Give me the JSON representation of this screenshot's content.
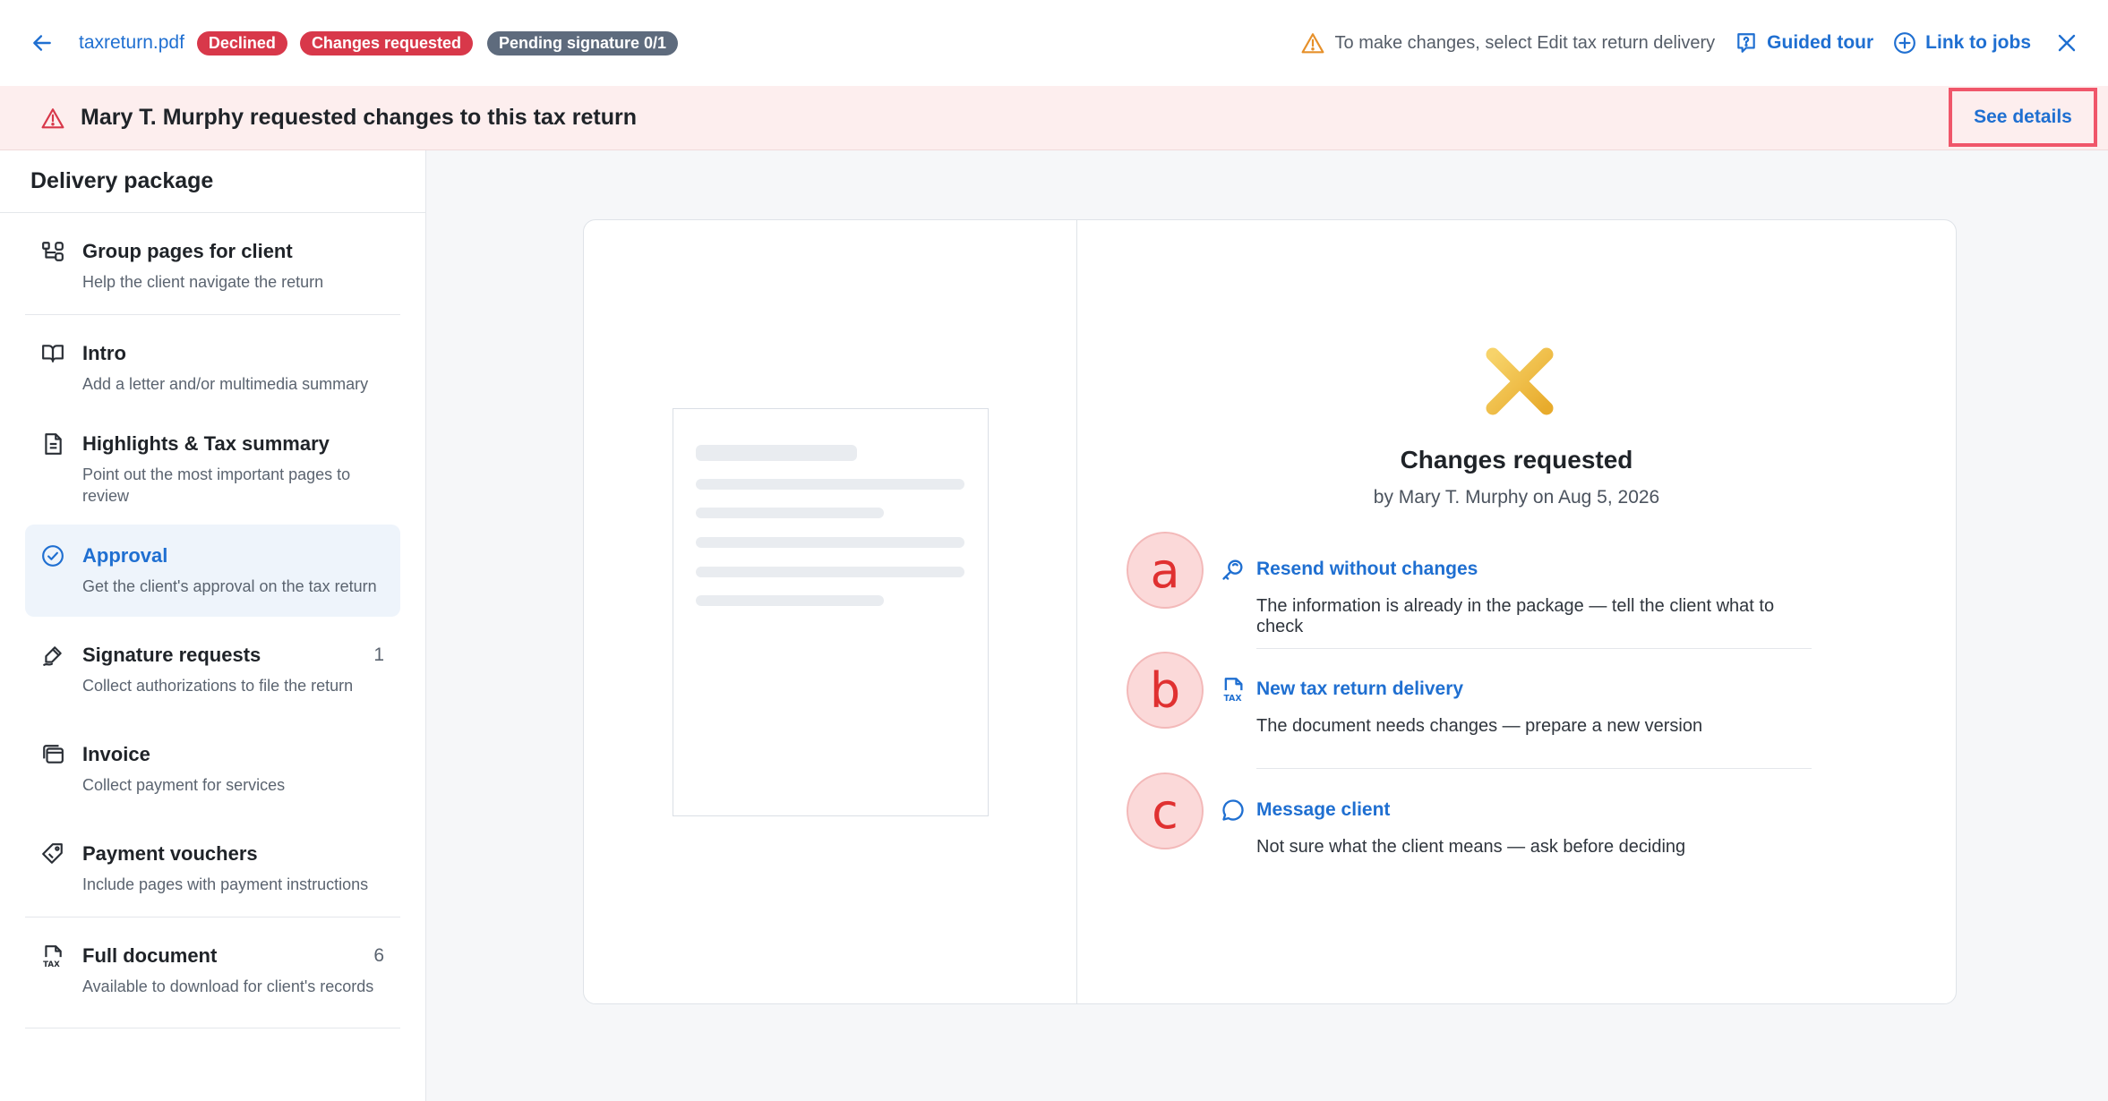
{
  "topbar": {
    "filename": "taxreturn.pdf",
    "badges": {
      "declined": "Declined",
      "changes": "Changes requested",
      "pending": "Pending signature 0/1"
    },
    "hint": "To make changes, select Edit tax return delivery",
    "guided_tour": "Guided tour",
    "link_to_jobs": "Link to jobs"
  },
  "banner": {
    "message": "Mary T. Murphy requested changes to this tax return",
    "see_details": "See details"
  },
  "sidebar": {
    "title": "Delivery package",
    "items": [
      {
        "label": "Group pages for client",
        "desc": "Help the client navigate the return",
        "count": ""
      },
      {
        "label": "Intro",
        "desc": "Add a letter and/or multimedia summary",
        "count": ""
      },
      {
        "label": "Highlights & Tax summary",
        "desc": "Point out the most important pages to review",
        "count": ""
      },
      {
        "label": "Approval",
        "desc": "Get the client's approval on the tax return",
        "count": ""
      },
      {
        "label": "Signature requests",
        "desc": "Collect authorizations to file the return",
        "count": "1"
      },
      {
        "label": "Invoice",
        "desc": "Collect payment for services",
        "count": ""
      },
      {
        "label": "Payment vouchers",
        "desc": "Include pages with payment instructions",
        "count": ""
      },
      {
        "label": "Full document",
        "desc": "Available to download for client's records",
        "count": "6"
      }
    ]
  },
  "main": {
    "status_title": "Changes requested",
    "status_by": "by Mary T. Murphy on Aug 5, 2026",
    "options": [
      {
        "letter": "a",
        "label": "Resend without changes",
        "desc": "The information is already in the package — tell the client what to check"
      },
      {
        "letter": "b",
        "label": "New tax return delivery",
        "desc": "The document needs changes — prepare a new version"
      },
      {
        "letter": "c",
        "label": "Message client",
        "desc": "Not sure what the client means — ask before deciding"
      }
    ]
  },
  "colors": {
    "accent": "#1f6fd1",
    "danger": "#d8384a",
    "banner_bg": "#fdeeee",
    "x_mark": "#f0c045"
  }
}
